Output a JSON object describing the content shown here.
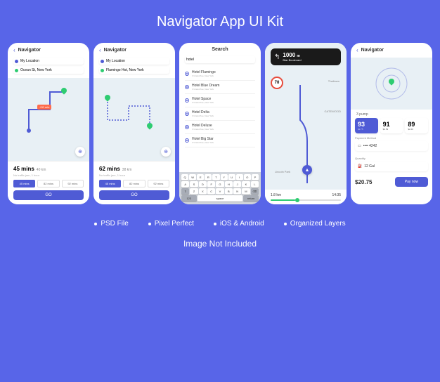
{
  "title": "Navigator App UI Kit",
  "features": [
    "PSD File",
    "Pixel Perfect",
    "iOS & Android",
    "Organized Layers"
  ],
  "note": "Image Not Included",
  "s1": {
    "title": "Navigator",
    "from": "My Location",
    "to": "Ocean St, New York",
    "time": "45 mins",
    "dist": "40 km",
    "sub": "No traffic jam, 1 hour",
    "badge": "+20 min",
    "chips": [
      "45 mins",
      "82 mins",
      "92 mins"
    ],
    "go": "GO"
  },
  "s2": {
    "title": "Navigator",
    "from": "My Location",
    "to": "Flamingo Hot, New York",
    "time": "62 mins",
    "dist": "38 km",
    "sub": "No traffic jam, 1 hour",
    "chips": [
      "45 mins",
      "82 mins",
      "92 mins"
    ],
    "go": "GO"
  },
  "s3": {
    "title": "Search",
    "query": "hotel",
    "results": [
      {
        "n": "Hotel Flamingo",
        "s": "3 Grand Ave, New York"
      },
      {
        "n": "Hotel Blue Dream",
        "s": "3 Grand Ave, New York"
      },
      {
        "n": "Hotel Space",
        "s": "3 Grand Ave, New York"
      },
      {
        "n": "Hotel Delta",
        "s": "3 Grand Ave, New York"
      },
      {
        "n": "Hotel Deluxe",
        "s": "3 Grand Ave, New York"
      },
      {
        "n": "Hotel Big Star",
        "s": "3 Grand Ave, New York"
      }
    ],
    "kb": {
      "r1": [
        "Q",
        "W",
        "E",
        "R",
        "T",
        "Y",
        "U",
        "I",
        "O",
        "P"
      ],
      "r2": [
        "A",
        "S",
        "D",
        "F",
        "G",
        "H",
        "J",
        "K",
        "L"
      ],
      "r3": [
        "⇧",
        "Z",
        "X",
        "C",
        "V",
        "B",
        "N",
        "M",
        "⌫"
      ],
      "r4": [
        "123",
        "space",
        "return"
      ]
    }
  },
  "s4": {
    "dist": "1000",
    "unit": "m",
    "street": "Blar Boulevard",
    "speed": "70",
    "label1": "Thaltown",
    "label2": "GATEWOOD",
    "label3": "Lincoln Park",
    "btm_dist": "1.8 km",
    "btm_time": "14:35"
  },
  "s5": {
    "title": "Navigator",
    "station": "3 pump",
    "stats": [
      {
        "n": "93",
        "l": "$2.75"
      },
      {
        "n": "91",
        "l": "$2.59"
      },
      {
        "n": "89",
        "l": "$2.40"
      }
    ],
    "pm_label": "Payment Method",
    "pm_value": "•••• 4242",
    "qty_label": "Quantity",
    "qty_value": "12 Gal",
    "price": "$20.75",
    "btn": "Pay now"
  }
}
